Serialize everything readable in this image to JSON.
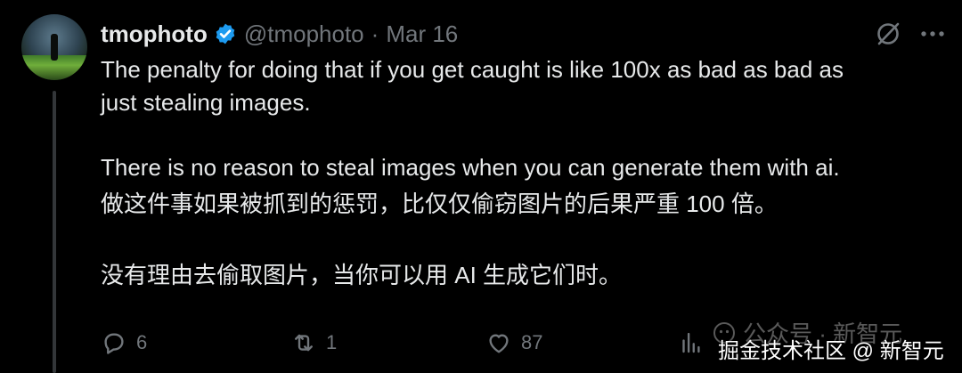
{
  "author": {
    "name": "tmophoto",
    "handle": "@tmophoto",
    "separator": "·",
    "date": "Mar 16"
  },
  "tweet": {
    "en_line1": "The penalty for doing that if you get caught is like 100x as bad as bad as",
    "en_line2": "just stealing images.",
    "en_line3": "There is no reason to steal images when you can generate them with ai.",
    "zh_line1": "做这件事如果被抓到的惩罚，比仅仅偷窃图片的后果严重 100 倍。",
    "zh_line2": "没有理由去偷取图片，当你可以用 AI 生成它们时。"
  },
  "actions": {
    "reply_count": "6",
    "retweet_count": "1",
    "like_count": "87"
  },
  "watermark": {
    "line1": "公众号 · 新智元",
    "line2": "掘金技术社区 @ 新智元"
  },
  "colors": {
    "background": "#000000",
    "text": "#e7e9ea",
    "muted": "#71767b",
    "verified": "#1d9bf0",
    "thread_line": "#333639"
  },
  "icons": [
    "verified-badge-icon",
    "grok-icon",
    "more-icon",
    "reply-icon",
    "retweet-icon",
    "like-icon",
    "views-icon",
    "wechat-icon"
  ]
}
